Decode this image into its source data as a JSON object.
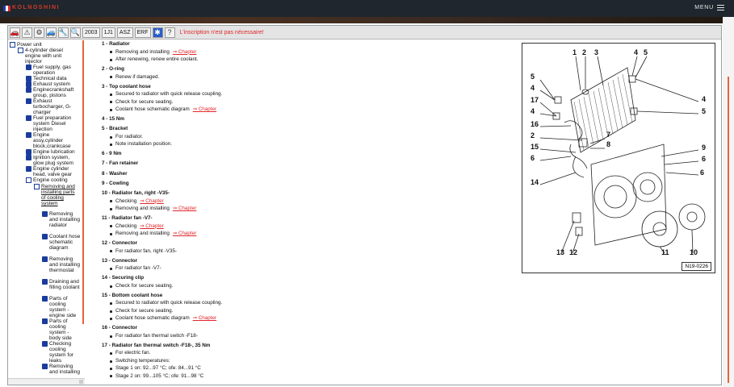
{
  "header": {
    "brand": "KOLNOSHINI",
    "menu_label": "MENU",
    "flag_colors": [
      "#1e3ca0",
      "#ffffff",
      "#e0262a"
    ]
  },
  "toolbar": {
    "icons": [
      "car-icon",
      "warning-icon",
      "engine-icon",
      "car-side-icon",
      "tools-icon",
      "search-icon"
    ],
    "buttons": [
      "2003",
      "1J1",
      "ASZ",
      "ERF"
    ],
    "settings_icon": "gear-icon",
    "help_icon": "help-icon",
    "message": "L'inscription n'est pas nécessaire!"
  },
  "tree": {
    "items": [
      {
        "label": "Power unit",
        "icon": "open-book-icon",
        "link": false
      },
      {
        "label": "4-cylinder diesel engine with unit injector",
        "icon": "open-book-icon",
        "link": false
      },
      {
        "label": "Fuel supply, gas operation",
        "icon": "book-icon",
        "link": false
      },
      {
        "label": "Technical data",
        "icon": "book-icon",
        "link": false
      },
      {
        "label": "Exhaust system",
        "icon": "book-icon",
        "link": false
      },
      {
        "label": "Enginecrankshaft group, pistons",
        "icon": "book-icon",
        "link": false
      },
      {
        "label": "Exhaust turbocharger, G-charger",
        "icon": "book-icon",
        "link": false
      },
      {
        "label": "Fuel preparation system Diesel injection",
        "icon": "book-icon",
        "link": false
      },
      {
        "label": "Engine assy,cylinder block,crankcase",
        "icon": "book-icon",
        "link": false
      },
      {
        "label": "Engine lubrication",
        "icon": "book-icon",
        "link": false
      },
      {
        "label": "Ignition system, glow plug system",
        "icon": "book-icon",
        "link": false
      },
      {
        "label": "Engine cylinder head, valve gear",
        "icon": "book-icon",
        "link": false
      },
      {
        "label": "Engine cooling",
        "icon": "open-book-icon",
        "link": false
      },
      {
        "label": "Removing and installing parts of cooling system",
        "icon": "open-book-icon",
        "link": true
      },
      {
        "label": "Removing and installing radiator",
        "icon": "book-icon",
        "link": false
      },
      {
        "label": "Coolant hose schematic diagram",
        "icon": "book-icon",
        "link": false
      },
      {
        "label": "Removing and installing thermostat",
        "icon": "book-icon",
        "link": false
      },
      {
        "label": "Draining and filling coolant",
        "icon": "book-icon",
        "link": false
      },
      {
        "label": "Parts of cooling system - engine side",
        "icon": "book-icon",
        "link": false
      },
      {
        "label": "Parts of cooling system - body side",
        "icon": "book-icon",
        "link": false
      },
      {
        "label": "Checking cooling system for leaks",
        "icon": "book-icon",
        "link": false
      },
      {
        "label": "Removing and installing",
        "icon": "book-icon",
        "link": false
      }
    ]
  },
  "content": {
    "link_text": "⇒ Chapter",
    "sections": [
      {
        "title": "1 - Radiator",
        "items": [
          {
            "text": "Removing and installing",
            "link": true
          },
          {
            "text": "After renewing, renew entire coolant.",
            "link": false
          }
        ]
      },
      {
        "title": "2 - O-ring",
        "items": [
          {
            "text": "Renew if damaged.",
            "link": false
          }
        ]
      },
      {
        "title": "3 - Top coolant hose",
        "items": [
          {
            "text": "Secured to radiator with quick release coupling.",
            "link": false
          },
          {
            "text": "Check for secure seating.",
            "link": false
          },
          {
            "text": "Coolant hose schematic diagram",
            "link": true
          }
        ]
      },
      {
        "title": "4 - 15 Nm",
        "items": []
      },
      {
        "title": "5 - Bracket",
        "items": [
          {
            "text": "For radiator.",
            "link": false
          },
          {
            "text": "Note installation position.",
            "link": false
          }
        ]
      },
      {
        "title": "6 - 9 Nm",
        "items": []
      },
      {
        "title": "7 - Fan retainer",
        "items": []
      },
      {
        "title": "8 - Washer",
        "items": []
      },
      {
        "title": "9 - Cowling",
        "items": []
      },
      {
        "title": "10 - Radiator fan, right -V35-",
        "items": [
          {
            "text": "Checking",
            "link": true
          },
          {
            "text": "Removing and installing",
            "link": true
          }
        ]
      },
      {
        "title": "11 - Radiator fan -V7-",
        "items": [
          {
            "text": "Checking",
            "link": true
          },
          {
            "text": "Removing and installing",
            "link": true
          }
        ]
      },
      {
        "title": "12 - Connector",
        "items": [
          {
            "text": "For radiator fan, right -V35-",
            "link": false
          }
        ]
      },
      {
        "title": "13 - Connector",
        "items": [
          {
            "text": "For radiator fan -V7-",
            "link": false
          }
        ]
      },
      {
        "title": "14 - Securing clip",
        "items": [
          {
            "text": "Check for secure seating.",
            "link": false
          }
        ]
      },
      {
        "title": "15 - Bottom coolant hose",
        "items": [
          {
            "text": "Secured to radiator with quick release coupling.",
            "link": false
          },
          {
            "text": "Check for secure seating.",
            "link": false
          },
          {
            "text": "Coolant hose schematic diagram",
            "link": true
          }
        ]
      },
      {
        "title": "16 - Connector",
        "items": [
          {
            "text": "For radiator fan thermal switch -F18-",
            "link": false
          }
        ]
      },
      {
        "title": "17 - Radiator fan thermal switch -F18-, 35 Nm",
        "items": [
          {
            "text": "For electric fan.",
            "link": false
          },
          {
            "text": "Switching temperatures:",
            "link": false
          },
          {
            "text": "Stage 1 on: 92...97 °C; ofe: 84...91 °C",
            "link": false
          },
          {
            "text": "Stage 2 on: 99...105 °C; ofe: 91...98 °C",
            "link": false
          }
        ]
      }
    ]
  },
  "diagram": {
    "code": "N19-0226",
    "labels": [
      "1",
      "2",
      "3",
      "4",
      "5",
      "5",
      "4",
      "17",
      "4",
      "16",
      "2",
      "15",
      "6",
      "14",
      "6",
      "7",
      "8",
      "9",
      "6",
      "4",
      "5",
      "13",
      "12",
      "11",
      "10"
    ]
  }
}
